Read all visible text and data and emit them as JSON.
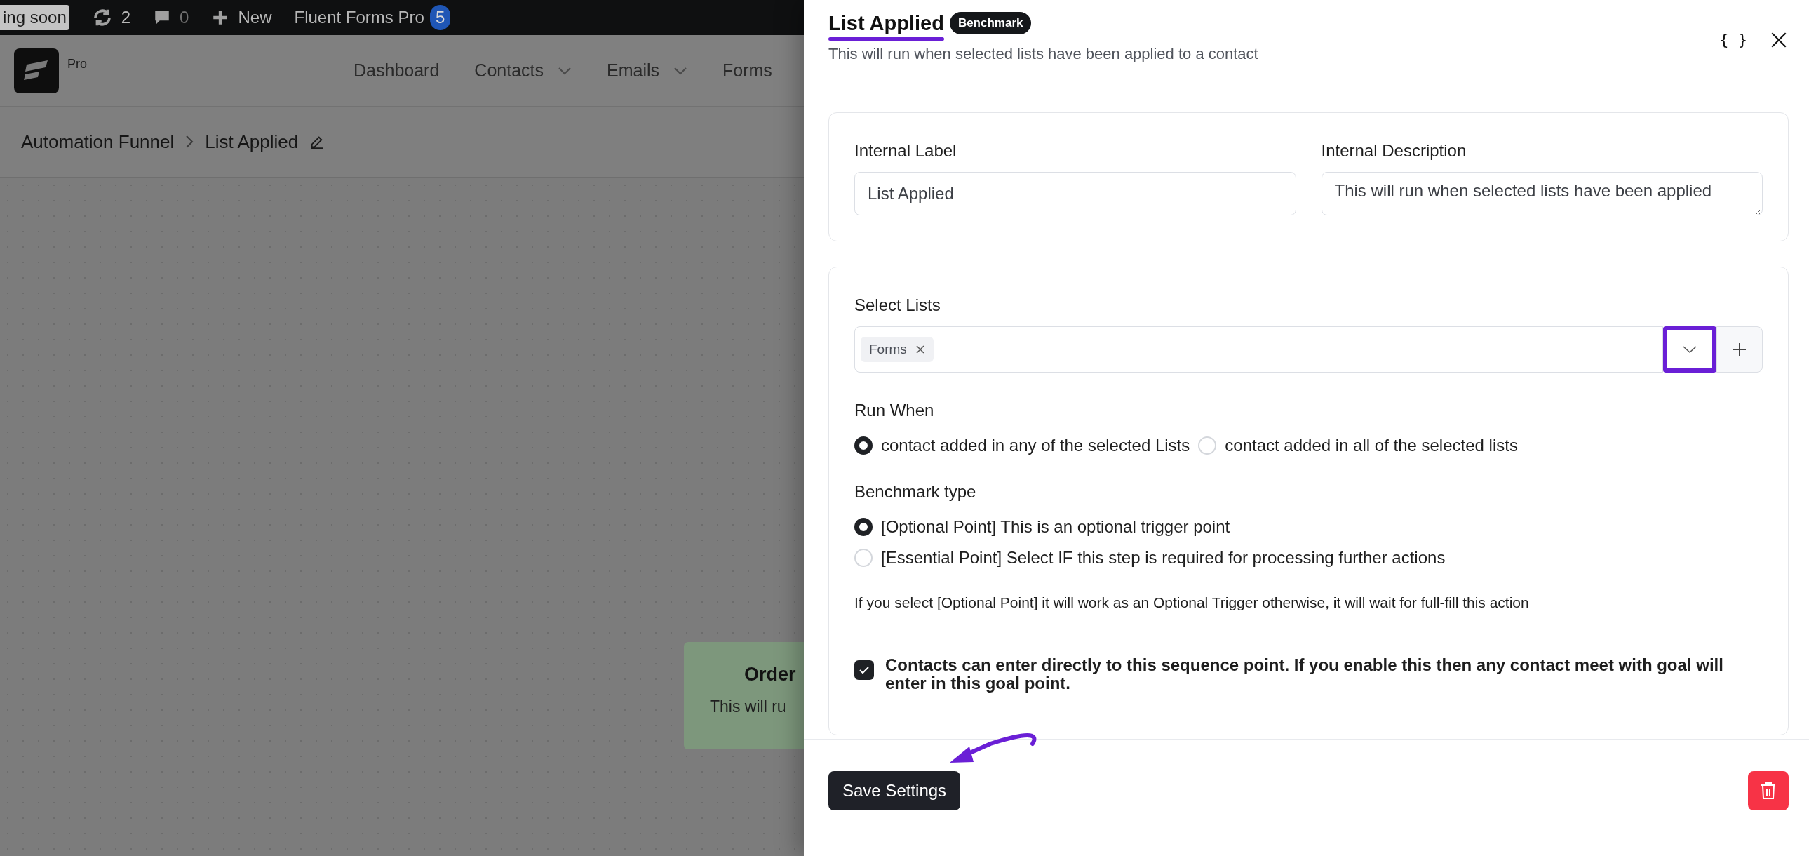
{
  "admin_bar": {
    "items": [
      {
        "kind": "badge",
        "label": "ing soon"
      },
      {
        "kind": "updates",
        "label": "2"
      },
      {
        "kind": "comments",
        "label": "0"
      },
      {
        "kind": "new",
        "label": "New"
      },
      {
        "kind": "plugin",
        "label": "Fluent Forms Pro",
        "count": "5"
      }
    ]
  },
  "nav": {
    "logo_label": "Pro",
    "items": [
      {
        "label": "Dashboard",
        "dropdown": false
      },
      {
        "label": "Contacts",
        "dropdown": true
      },
      {
        "label": "Emails",
        "dropdown": true
      },
      {
        "label": "Forms",
        "dropdown": false
      }
    ]
  },
  "breadcrumb": [
    "Automation Funnel",
    "List Applied"
  ],
  "canvas_card": {
    "title": "Order",
    "text": "This will ru"
  },
  "drawer": {
    "title": "List Applied",
    "badge": "Benchmark",
    "subtitle": "This will run when selected lists have been applied to a contact",
    "code_button": "{ }",
    "internal_label": {
      "label": "Internal Label",
      "value": "List Applied"
    },
    "internal_description": {
      "label": "Internal Description",
      "value": "This will run when selected lists have been applied"
    },
    "select_lists": {
      "label": "Select Lists",
      "tags": [
        "Forms"
      ]
    },
    "run_when": {
      "label": "Run When",
      "options": [
        {
          "label": "contact added in any of the selected Lists",
          "selected": true
        },
        {
          "label": "contact added in all of the selected lists",
          "selected": false
        }
      ]
    },
    "benchmark_type": {
      "label": "Benchmark type",
      "options": [
        {
          "label": "[Optional Point] This is an optional trigger point",
          "selected": true
        },
        {
          "label": "[Essential Point] Select IF this step is required for processing further actions",
          "selected": false
        }
      ]
    },
    "note": "If you select [Optional Point] it will work as an Optional Trigger otherwise, it will wait for full-fill this action",
    "direct_entry": {
      "label": "Contacts can enter directly to this sequence point. If you enable this then any contact meet with goal will enter in this goal point.",
      "checked": true
    },
    "save_button": "Save Settings"
  }
}
